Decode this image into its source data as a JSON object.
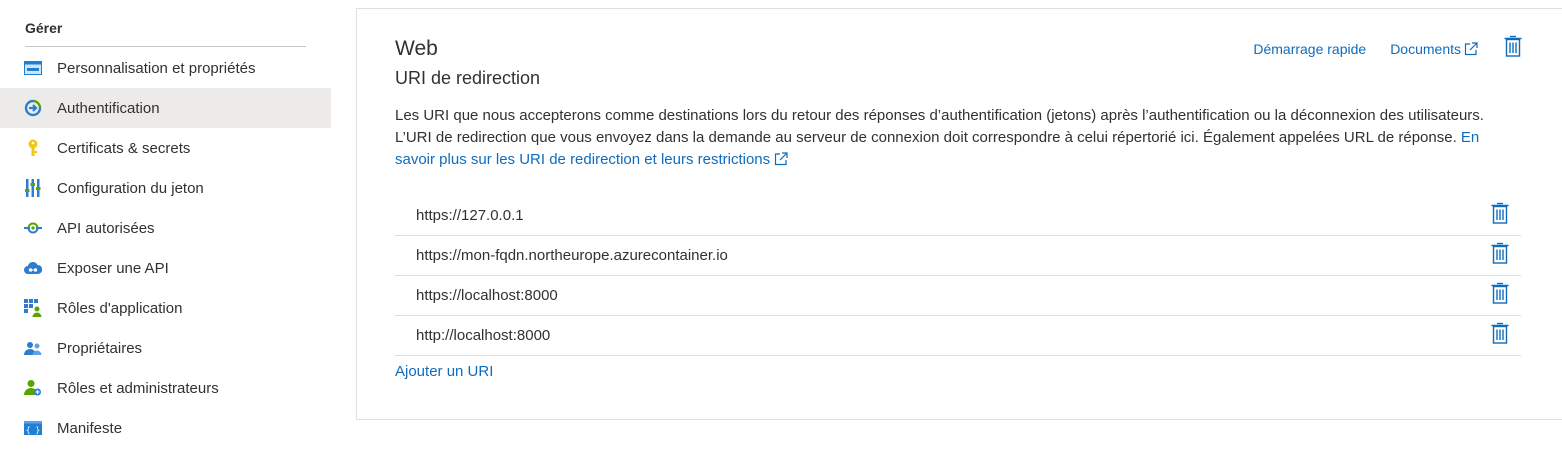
{
  "sidebar": {
    "section_title": "Gérer",
    "items": [
      {
        "label": "Personnalisation et propriétés",
        "icon": "branding-icon"
      },
      {
        "label": "Authentification",
        "icon": "authentication-icon",
        "active": true
      },
      {
        "label": "Certificats & secrets",
        "icon": "key-icon"
      },
      {
        "label": "Configuration du jeton",
        "icon": "token-configuration-icon"
      },
      {
        "label": "API autorisées",
        "icon": "api-permissions-icon"
      },
      {
        "label": "Exposer une API",
        "icon": "expose-api-icon"
      },
      {
        "label": "Rôles d'application",
        "icon": "app-roles-icon"
      },
      {
        "label": "Propriétaires",
        "icon": "owners-icon"
      },
      {
        "label": "Rôles et administrateurs",
        "icon": "roles-admins-icon"
      },
      {
        "label": "Manifeste",
        "icon": "manifest-icon"
      }
    ]
  },
  "card": {
    "title": "Web",
    "subtitle": "URI de redirection",
    "quickstart_link": "Démarrage rapide",
    "docs_link": "Documents",
    "description_text": "Les URI que nous accepterons comme destinations lors du retour des réponses d’authentification (jetons) après l’authentification ou la déconnexion des utilisateurs. L’URI de redirection que vous envoyez dans la demande au serveur de connexion doit correspondre à celui répertorié ici. Également appelées URL de réponse. ",
    "learn_more_link": "En savoir plus sur les URI de redirection et leurs restrictions",
    "redirect_uris": [
      "https://127.0.0.1",
      "https://mon-fqdn.northeurope.azurecontainer.io",
      "https://localhost:8000",
      "http://localhost:8000"
    ],
    "add_uri_label": "Ajouter un URI"
  },
  "colors": {
    "accent": "#0f6cbd",
    "active_item_bg": "#edebe9",
    "text": "#323130",
    "border": "#e1dfdd"
  }
}
